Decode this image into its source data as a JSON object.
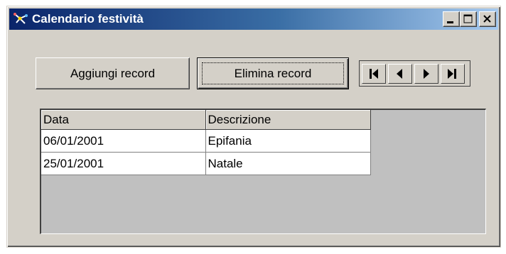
{
  "window": {
    "title": "Calendario festività"
  },
  "toolbar": {
    "add_label": "Aggiungi record",
    "delete_label": "Elimina record"
  },
  "navigator": {
    "buttons": [
      "first",
      "previous",
      "next",
      "last"
    ]
  },
  "grid": {
    "columns": [
      "Data",
      "Descrizione"
    ],
    "rows": [
      {
        "data": "06/01/2001",
        "descrizione": "Epifania"
      },
      {
        "data": "25/01/2001",
        "descrizione": "Natale"
      }
    ]
  },
  "colors": {
    "titlebar_start": "#0a246a",
    "titlebar_end": "#a6caf0",
    "face": "#d4d0c8",
    "grid_background": "#c0c0c0"
  }
}
